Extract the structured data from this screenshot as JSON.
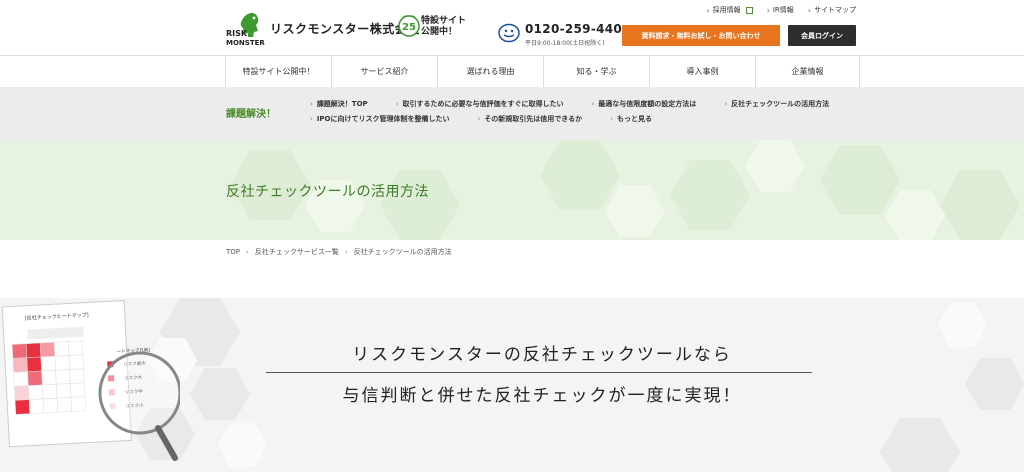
{
  "header": {
    "logo_text": "RISK MONSTER",
    "company_name": "リスクモンスター株式会社",
    "badge_number": "25",
    "special_site_l1": "特設サイト",
    "special_site_l2": "公開中！",
    "top_links": [
      "採用情報",
      "IR情報",
      "サイトマップ"
    ],
    "phone": "0120-259-440",
    "hours": "平日9:00-18:00(土日祝除く)",
    "request_button": "資料請求・無料お試し・お問い合わせ",
    "login_button": "会員ログイン"
  },
  "nav": {
    "items": [
      "特設サイト公開中！",
      "サービス紹介",
      "選ばれる理由",
      "知る・学ぶ",
      "導入事例",
      "企業情報"
    ]
  },
  "issues": {
    "title": "課題解決！",
    "links": [
      "課題解決！TOP",
      "取引するために必要な与信評価をすぐに取得したい",
      "最適な与信限度額の設定方法は",
      "反社チェックツールの活用方法",
      "IPOに向けてリスク管理体制を整備したい",
      "その新規取引先は信用できるか",
      "もっと見る"
    ]
  },
  "page": {
    "title": "反社チェックツールの活用方法"
  },
  "breadcrumb": {
    "items": [
      "TOP",
      "反社チェックサービス一覧",
      "反社チェックツールの活用方法"
    ]
  },
  "hero": {
    "line1": "リスクモンスターの反社チェックツールなら",
    "line2": "与信判断と併せた反社チェックが一度に実現！",
    "heatmap_title": "[反社チェックヒートマップ]",
    "legend_title": "ートマップ凡例]",
    "legend_items": [
      "リスク最大",
      "リスク大",
      "リスク中",
      "リスク小"
    ]
  },
  "colors": {
    "accent_green": "#4a8a2a",
    "orange": "#e8741e",
    "dark": "#2e2e2e",
    "title_band": "#e7f2e1"
  }
}
